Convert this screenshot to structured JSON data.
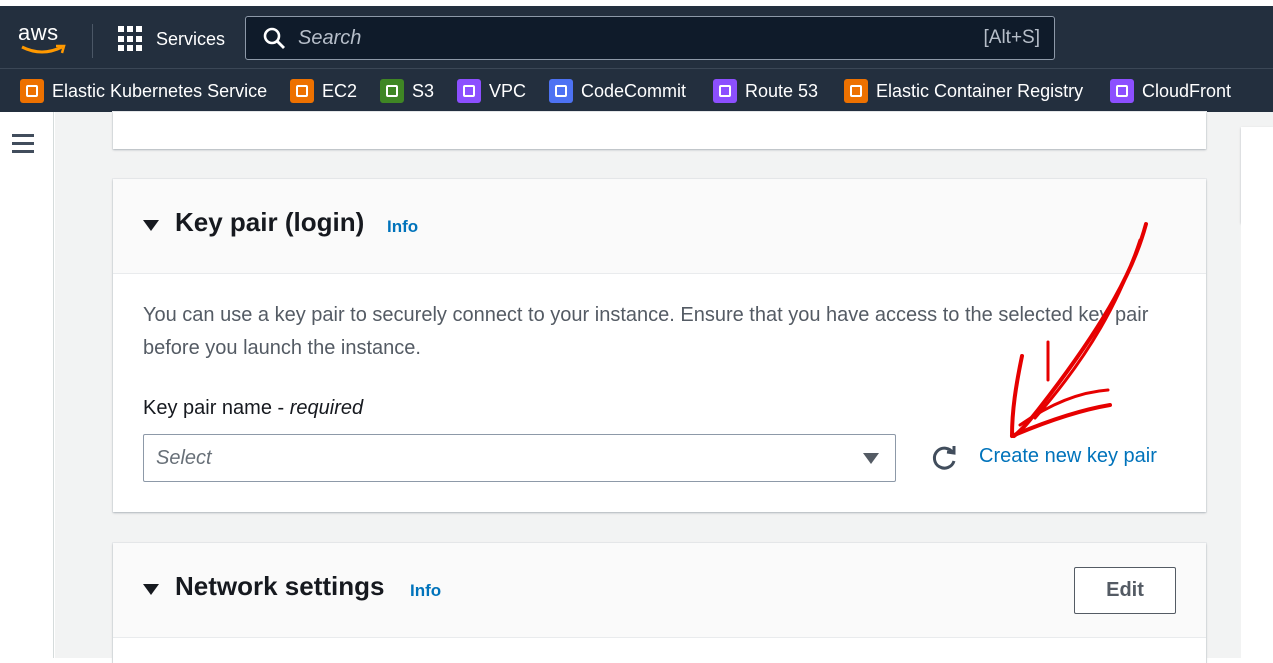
{
  "topbar": {
    "logo_text": "aws",
    "services_label": "Services",
    "search_placeholder": "Search",
    "search_shortcut": "[Alt+S]"
  },
  "favorites": [
    {
      "label": "Elastic Kubernetes Service",
      "icon": "eks-icon",
      "color": "#ed7100"
    },
    {
      "label": "EC2",
      "icon": "ec2-icon",
      "color": "#ed7100"
    },
    {
      "label": "S3",
      "icon": "s3-icon",
      "color": "#3f8624"
    },
    {
      "label": "VPC",
      "icon": "vpc-icon",
      "color": "#8c4fff"
    },
    {
      "label": "CodeCommit",
      "icon": "codecommit-icon",
      "color": "#4d72f3"
    },
    {
      "label": "Route 53",
      "icon": "route53-icon",
      "color": "#8c4fff"
    },
    {
      "label": "Elastic Container Registry",
      "icon": "ecr-icon",
      "color": "#ed7100"
    },
    {
      "label": "CloudFront",
      "icon": "cloudfront-icon",
      "color": "#8c4fff"
    }
  ],
  "keypair": {
    "title": "Key pair (login)",
    "info": "Info",
    "description": "You can use a key pair to securely connect to your instance. Ensure that you have access to the selected key pair before you launch the instance.",
    "field_label": "Key pair name - ",
    "field_required": "required",
    "select_value": "Select",
    "create_link": "Create new key pair"
  },
  "network": {
    "title": "Network settings",
    "info": "Info",
    "edit_label": "Edit"
  },
  "colors": {
    "header_bg": "#232f3e",
    "link": "#0073bb",
    "annotation": "#e60000"
  }
}
